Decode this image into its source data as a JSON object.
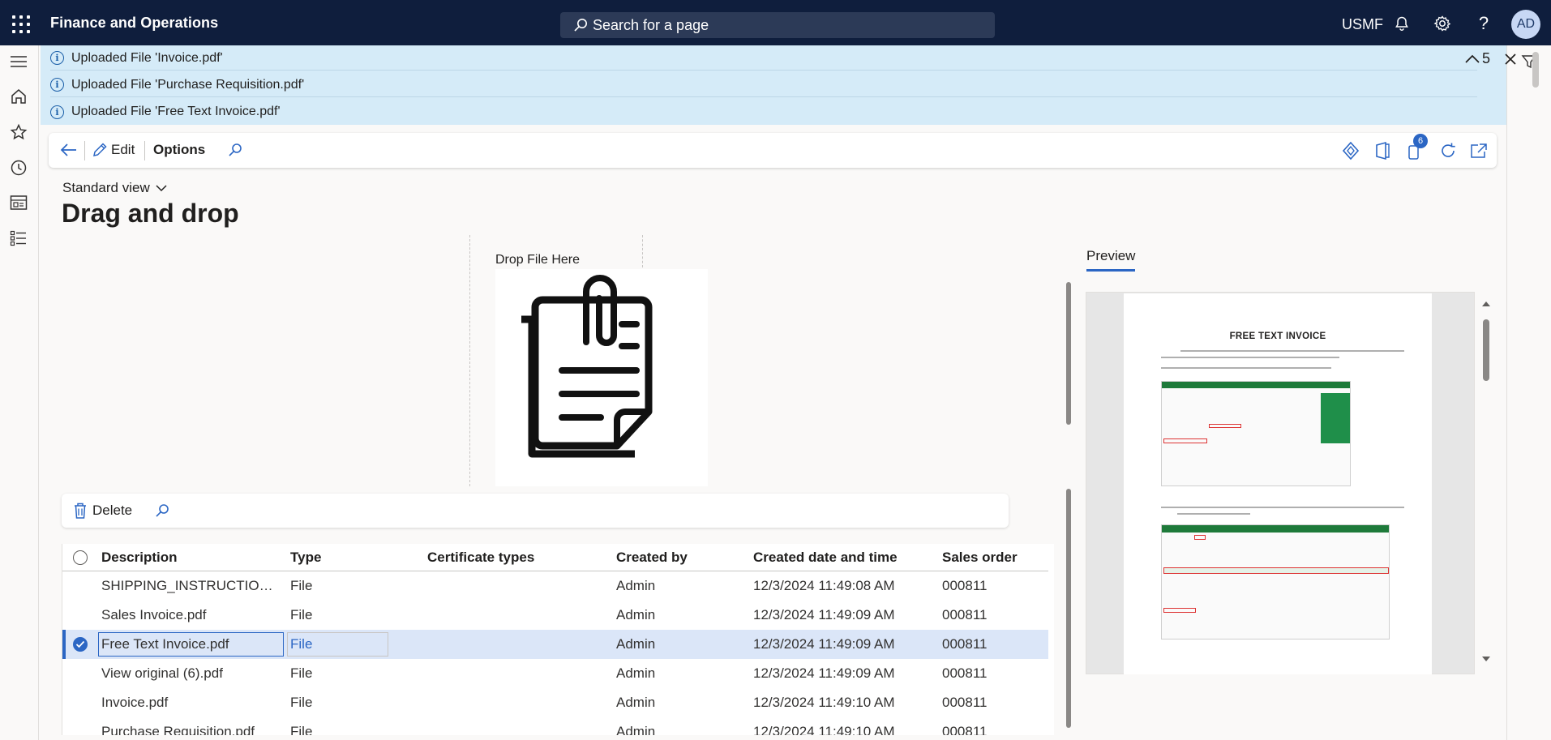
{
  "topbar": {
    "app_title": "Finance and Operations",
    "search_placeholder": "Search for a page",
    "company": "USMF",
    "avatar_initials": "AD",
    "icons": [
      "apps-waffle-icon",
      "search-icon",
      "bell-icon",
      "gear-icon",
      "help-icon"
    ]
  },
  "nav_rail": {
    "icons": [
      "hamburger-icon",
      "home-icon",
      "star-icon",
      "clock-icon",
      "workspace-icon",
      "modules-list-icon"
    ]
  },
  "messages": {
    "items": [
      "Uploaded File 'Invoice.pdf'",
      "Uploaded File 'Purchase Requisition.pdf'",
      "Uploaded File 'Free Text Invoice.pdf'"
    ],
    "count": "5"
  },
  "action_pane": {
    "edit_label": "Edit",
    "options_label": "Options",
    "attachments_badge": "6"
  },
  "page": {
    "view_name": "Standard view",
    "title": "Drag and drop",
    "drop_label": "Drop File Here",
    "preview_tab": "Preview"
  },
  "grid_toolbar": {
    "delete_label": "Delete"
  },
  "grid": {
    "columns": [
      "Description",
      "Type",
      "Certificate types",
      "Created by",
      "Created date and time",
      "Sales order"
    ],
    "rows": [
      {
        "description": "SHIPPING_INSTRUCTION_...",
        "type": "File",
        "certificate": "",
        "created_by": "Admin",
        "created": "12/3/2024 11:49:08 AM",
        "sales_order": "000811"
      },
      {
        "description": "Sales Invoice.pdf",
        "type": "File",
        "certificate": "",
        "created_by": "Admin",
        "created": "12/3/2024 11:49:09 AM",
        "sales_order": "000811"
      },
      {
        "description": "Free Text Invoice.pdf",
        "type": "File",
        "certificate": "",
        "created_by": "Admin",
        "created": "12/3/2024 11:49:09 AM",
        "sales_order": "000811"
      },
      {
        "description": "View original (6).pdf",
        "type": "File",
        "certificate": "",
        "created_by": "Admin",
        "created": "12/3/2024 11:49:09 AM",
        "sales_order": "000811"
      },
      {
        "description": "Invoice.pdf",
        "type": "File",
        "certificate": "",
        "created_by": "Admin",
        "created": "12/3/2024 11:49:10 AM",
        "sales_order": "000811"
      },
      {
        "description": "Purchase Requisition.pdf",
        "type": "File",
        "certificate": "",
        "created_by": "Admin",
        "created": "12/3/2024 11:49:10 AM",
        "sales_order": "000811"
      }
    ],
    "selected_row": 2
  },
  "preview_doc": {
    "title": "FREE TEXT INVOICE"
  },
  "colors": {
    "topbar": "#0f1e3d",
    "accent": "#2b66c4",
    "message_bar": "#d5ebf8",
    "selected_row": "#dbe6f8"
  }
}
